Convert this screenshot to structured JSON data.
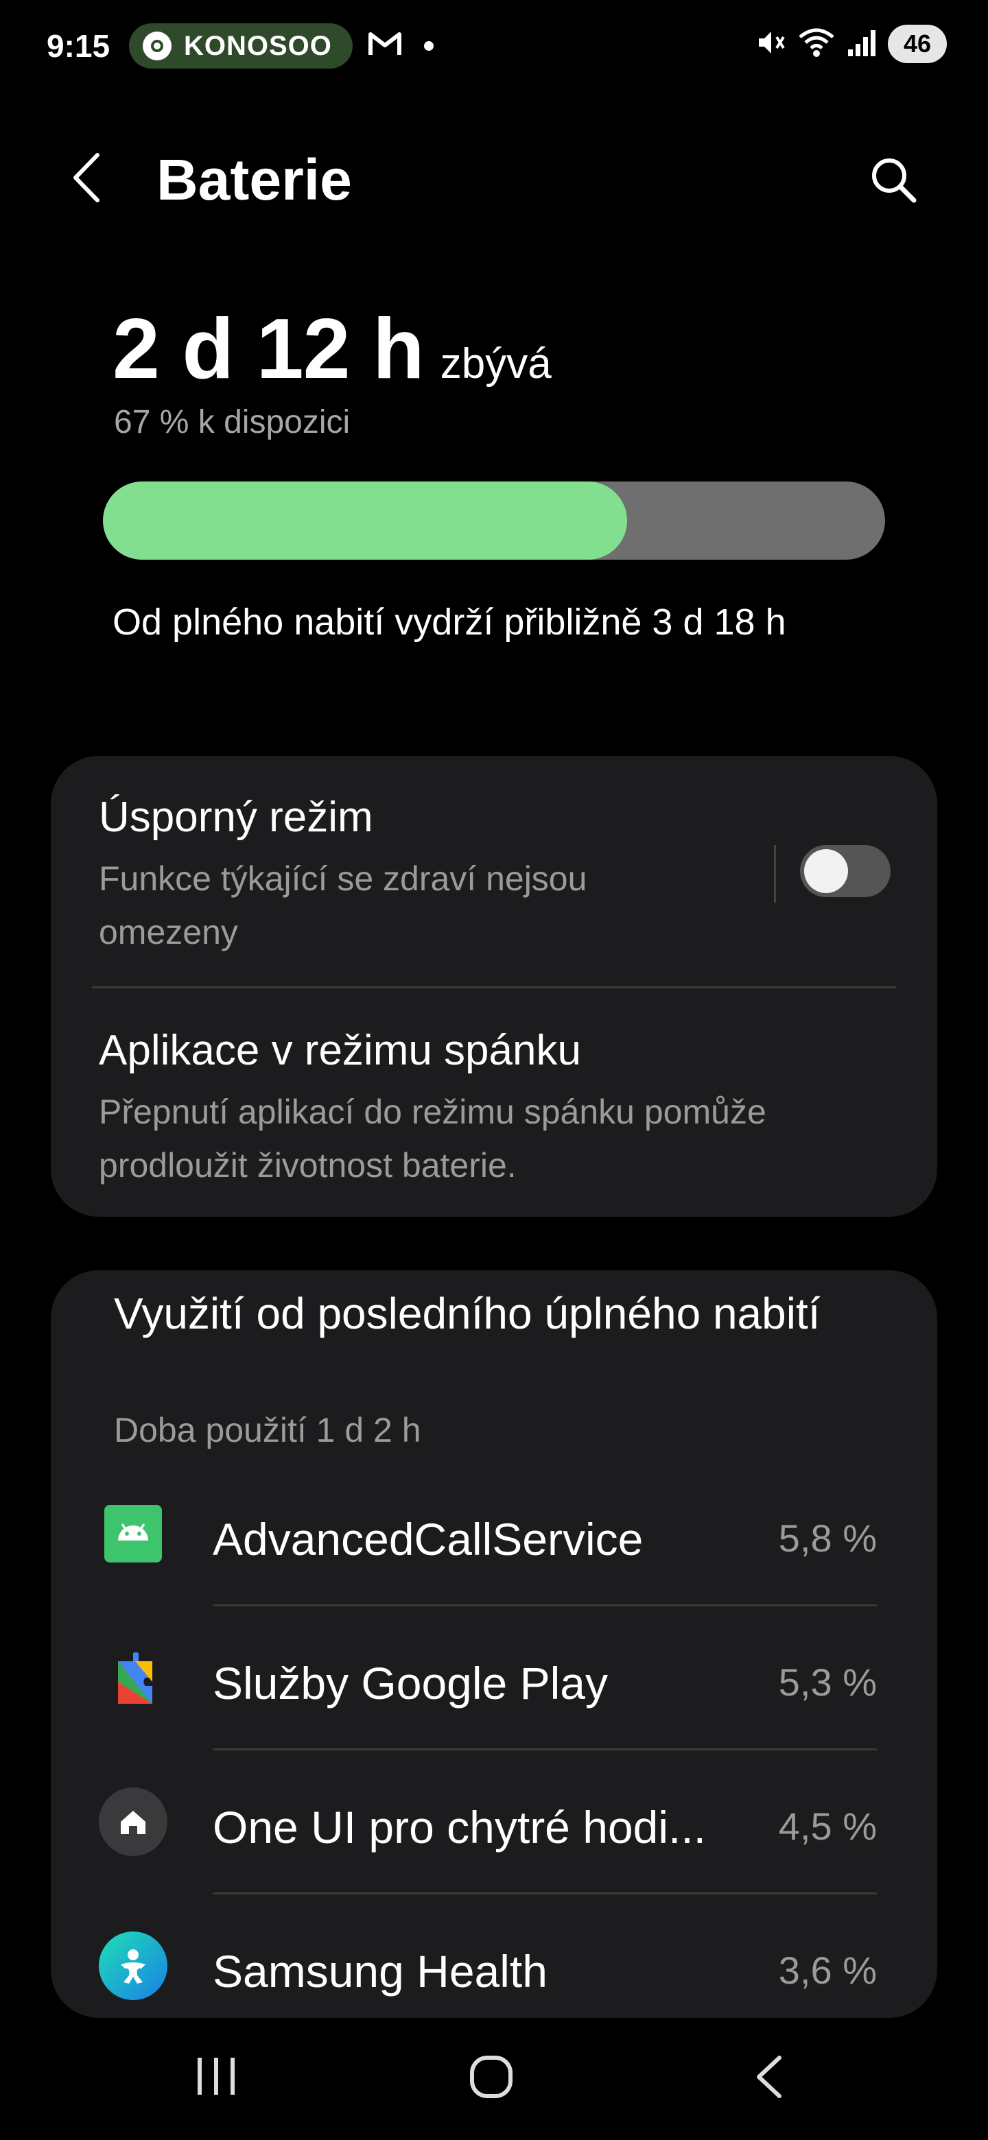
{
  "status_bar": {
    "time": "9:15",
    "notification_pill": "KONOSOO",
    "battery_level": "46"
  },
  "header": {
    "title": "Baterie"
  },
  "summary": {
    "remaining_value": "2 d 12 h",
    "remaining_label": "zbývá",
    "available": "67 % k dispozici",
    "battery_fraction": 0.67,
    "full_charge_estimate": "Od plného nabití vydrží přibližně 3 d 18 h"
  },
  "power_saving": {
    "title": "Úsporný režim",
    "subtitle": "Funkce týkající se zdraví nejsou omezeny",
    "toggle_on": false
  },
  "sleeping_apps": {
    "title": "Aplikace v režimu spánku",
    "subtitle": "Přepnutí aplikací do režimu spánku pomůže prodloužit životnost baterie."
  },
  "usage": {
    "title": "Využití od posledního úplného nabití",
    "subtitle": "Doba použití 1 d 2 h",
    "apps": [
      {
        "name": "AdvancedCallService",
        "percent": "5,8 %",
        "icon": "android-icon"
      },
      {
        "name": "Služby Google Play",
        "percent": "5,3 %",
        "icon": "google-play-services-icon"
      },
      {
        "name": "One UI pro chytré hodi...",
        "percent": "4,5 %",
        "icon": "home-icon"
      },
      {
        "name": "Samsung Health",
        "percent": "3,6 %",
        "icon": "samsung-health-icon"
      }
    ]
  },
  "colors": {
    "background": "#000000",
    "card": "#1c1c1e",
    "battery_fill": "#83df90",
    "battery_track": "#6f6f6f",
    "secondary_text": "#9b9b9b"
  }
}
